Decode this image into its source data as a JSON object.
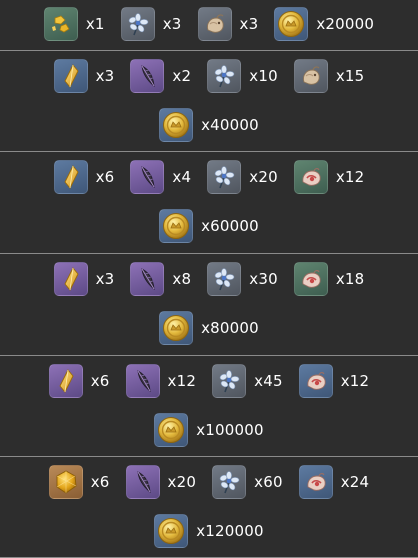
{
  "tiers": [
    {
      "items": [
        {
          "icon": "gold-nugget-icon",
          "quality": "q2",
          "qty": "x1"
        },
        {
          "icon": "blue-flower-icon",
          "quality": "q1",
          "qty": "x3"
        },
        {
          "icon": "tan-creature-icon",
          "quality": "q1",
          "qty": "x3"
        },
        {
          "icon": "mora-coin-icon",
          "quality": "q3",
          "qty": "x20000"
        }
      ]
    },
    {
      "items": [
        {
          "icon": "gold-crystal-icon",
          "quality": "q3",
          "qty": "x3"
        },
        {
          "icon": "dark-feather-icon",
          "quality": "q4",
          "qty": "x2"
        },
        {
          "icon": "blue-flower-icon",
          "quality": "q1",
          "qty": "x10"
        },
        {
          "icon": "tan-creature-icon",
          "quality": "q1",
          "qty": "x15"
        }
      ],
      "mora": {
        "icon": "mora-coin-icon",
        "quality": "q3",
        "qty": "x40000"
      }
    },
    {
      "items": [
        {
          "icon": "gold-crystal-icon",
          "quality": "q3",
          "qty": "x6"
        },
        {
          "icon": "dark-feather-icon",
          "quality": "q4",
          "qty": "x4"
        },
        {
          "icon": "blue-flower-icon",
          "quality": "q1",
          "qty": "x20"
        },
        {
          "icon": "pink-creature-icon",
          "quality": "q2",
          "qty": "x12"
        }
      ],
      "mora": {
        "icon": "mora-coin-icon",
        "quality": "q3",
        "qty": "x60000"
      }
    },
    {
      "items": [
        {
          "icon": "gold-crystal-icon",
          "quality": "q4",
          "qty": "x3"
        },
        {
          "icon": "dark-feather-icon",
          "quality": "q4",
          "qty": "x8"
        },
        {
          "icon": "blue-flower-icon",
          "quality": "q1",
          "qty": "x30"
        },
        {
          "icon": "pink-creature-icon",
          "quality": "q2",
          "qty": "x18"
        }
      ],
      "mora": {
        "icon": "mora-coin-icon",
        "quality": "q3",
        "qty": "x80000"
      }
    },
    {
      "items": [
        {
          "icon": "gold-crystal-icon",
          "quality": "q4",
          "qty": "x6"
        },
        {
          "icon": "dark-feather-icon",
          "quality": "q4",
          "qty": "x12"
        },
        {
          "icon": "blue-flower-icon",
          "quality": "q1",
          "qty": "x45"
        },
        {
          "icon": "pink-creature-icon",
          "quality": "q3",
          "qty": "x12"
        }
      ],
      "mora": {
        "icon": "mora-coin-icon",
        "quality": "q3",
        "qty": "x100000"
      }
    },
    {
      "items": [
        {
          "icon": "gold-gem-icon",
          "quality": "q5",
          "qty": "x6"
        },
        {
          "icon": "dark-feather-icon",
          "quality": "q4",
          "qty": "x20"
        },
        {
          "icon": "blue-flower-icon",
          "quality": "q1",
          "qty": "x60"
        },
        {
          "icon": "pink-creature-icon",
          "quality": "q3",
          "qty": "x24"
        }
      ],
      "mora": {
        "icon": "mora-coin-icon",
        "quality": "q3",
        "qty": "x120000"
      }
    }
  ]
}
